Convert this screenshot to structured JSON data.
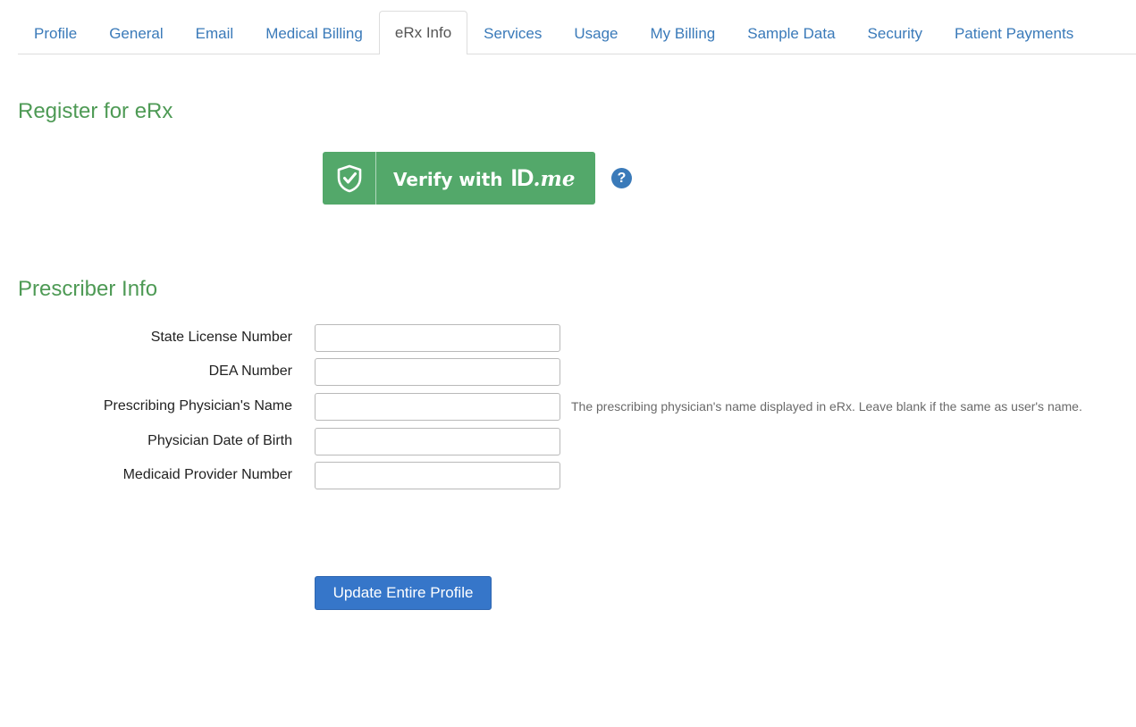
{
  "tabs": [
    {
      "label": "Profile"
    },
    {
      "label": "General"
    },
    {
      "label": "Email"
    },
    {
      "label": "Medical Billing"
    },
    {
      "label": "eRx Info",
      "active": true
    },
    {
      "label": "Services"
    },
    {
      "label": "Usage"
    },
    {
      "label": "My Billing"
    },
    {
      "label": "Sample Data"
    },
    {
      "label": "Security"
    },
    {
      "label": "Patient Payments"
    }
  ],
  "register": {
    "title": "Register for eRx",
    "verify_button": {
      "text": "Verify with",
      "logo_id": "ID",
      "logo_me": ".me",
      "icon": "shield-check-icon"
    },
    "help_icon": "question-circle-icon",
    "help_glyph": "?"
  },
  "prescriber": {
    "title": "Prescriber Info",
    "fields": [
      {
        "label": "State License Number",
        "value": "",
        "help": ""
      },
      {
        "label": "DEA Number",
        "value": "",
        "help": ""
      },
      {
        "label": "Prescribing Physician's Name",
        "value": "",
        "help": "The prescribing physician's name displayed in eRx. Leave blank if the same as user's name."
      },
      {
        "label": "Physician Date of Birth",
        "value": "",
        "help": ""
      },
      {
        "label": "Medicaid Provider Number",
        "value": "",
        "help": ""
      }
    ]
  },
  "actions": {
    "update_label": "Update Entire Profile"
  },
  "colors": {
    "link": "#3a7ab9",
    "heading": "#4e9a55",
    "idme_green": "#53a86a",
    "primary_button": "#3676c9"
  }
}
